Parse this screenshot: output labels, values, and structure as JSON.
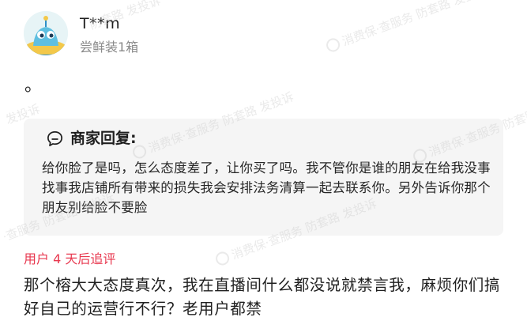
{
  "user": {
    "name": "T**m",
    "purchase_note": "尝鲜装1箱"
  },
  "comment": {
    "text": "。"
  },
  "merchant_reply": {
    "title": "商家回复:",
    "icon": "chat-bubble-icon",
    "body": "给你脸了是吗，怎么态度差了，让你买了吗。我不管你是谁的朋友在给我没事找事我店铺所有带来的损失我会安排法务清算一起去联系你。另外告诉你那个朋友别给脸不要脸"
  },
  "followup": {
    "label": "用户 4 天后追评",
    "body": "那个榕大大态度真次，我在直播间什么都没说就禁言我，麻烦你们搞好自己的运营行不行？老用户都禁"
  },
  "watermark": {
    "brand": "消费保",
    "slogan": "·查服务 防套路 发投诉",
    "fragment_1": "防套路 发投诉",
    "fragment_2": "发投诉"
  },
  "colors": {
    "followup_label": "#e8384f",
    "reply_background": "#f5f5f5",
    "secondary_text": "#8a8a8a"
  }
}
